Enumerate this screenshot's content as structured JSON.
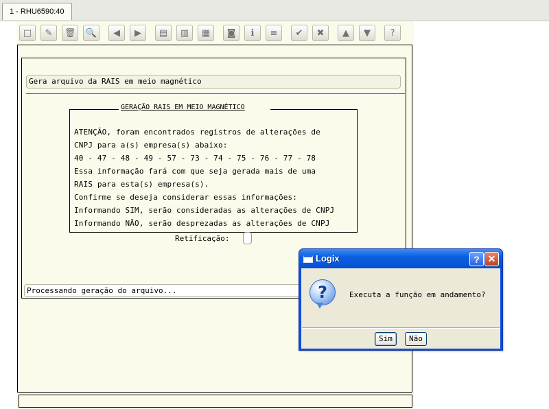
{
  "tab": {
    "label": "1 - RHU6590:40"
  },
  "toolbar": {
    "buttons": [
      {
        "name": "new-icon",
        "glyph": "□"
      },
      {
        "name": "edit-icon",
        "glyph": "✎"
      },
      {
        "name": "delete-icon",
        "glyph": "🗑"
      },
      {
        "name": "search-icon",
        "glyph": "🔍"
      },
      {
        "name": "previous-icon",
        "glyph": "◀"
      },
      {
        "name": "next-icon",
        "glyph": "▶"
      },
      {
        "name": "document-icon",
        "glyph": "▤"
      },
      {
        "name": "document-list-icon",
        "glyph": "▥"
      },
      {
        "name": "export-icon",
        "glyph": "▦"
      },
      {
        "name": "binoculars-icon",
        "glyph": "◙"
      },
      {
        "name": "info-icon",
        "glyph": "ℹ"
      },
      {
        "name": "zoom-icon",
        "glyph": "≡"
      },
      {
        "name": "confirm-icon",
        "glyph": "✔"
      },
      {
        "name": "cancel-icon",
        "glyph": "✖"
      },
      {
        "name": "up-icon",
        "glyph": "▲"
      },
      {
        "name": "down-icon",
        "glyph": "▼"
      },
      {
        "name": "help-icon",
        "glyph": "?"
      }
    ]
  },
  "form": {
    "title": "Gera arquivo da RAIS em meio magnético",
    "group_title": "GERAÇÃO RAIS EM MEIO MAGNÉTICO",
    "message_lines": [
      "ATENÇÃO, foram encontrados registros de alterações de",
      "CNPJ para a(s) empresa(s) abaixo:",
      "40 - 47 - 48 - 49 - 57 - 73 - 74 - 75 - 76 - 77 - 78",
      "Essa informação fará com que seja gerada mais de uma",
      "RAIS para esta(s) empresa(s).",
      "Confirme se deseja considerar essas informações:",
      "Informando SIM, serão consideradas as alterações de CNPJ",
      "Informando NÃO, serão desprezadas as alterações de CNPJ"
    ],
    "retificacao_label": "Retificação:",
    "retificacao_value": "",
    "status": "Processando geração do arquivo..."
  },
  "dialog": {
    "title": "Logix",
    "help_glyph": "?",
    "close_glyph": "✕",
    "icon_glyph": "?",
    "message": "Executa a função em andamento?",
    "yes_label": "Sim",
    "no_label": "Não"
  }
}
